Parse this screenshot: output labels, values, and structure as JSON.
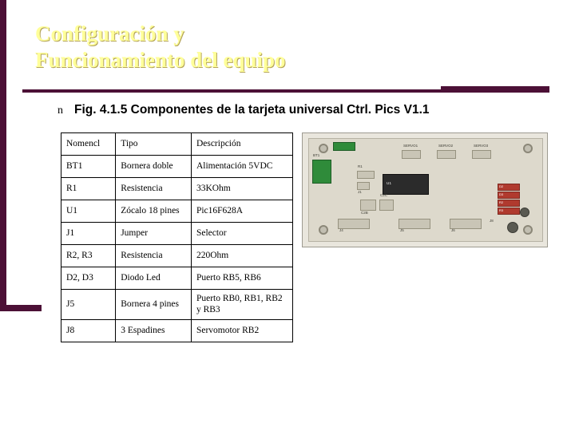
{
  "slide": {
    "title_line1": "Configuración y",
    "title_line2": "Funcionamiento del equipo",
    "bullet_marker": "n",
    "bullet_text": "Fig. 4.1.5 Componentes de la tarjeta universal Ctrl. Pics V1.1"
  },
  "colors": {
    "title_text": "#FFFF99",
    "accent_bar": "#4C1036",
    "background": "#FFFFFF"
  },
  "table": {
    "headers": [
      "Nomencl",
      "Tipo",
      "Descripción"
    ],
    "rows": [
      [
        "BT1",
        "Bornera doble",
        "Alimentación 5VDC"
      ],
      [
        "R1",
        "Resistencia",
        "33KOhm"
      ],
      [
        "U1",
        "Zócalo 18 pines",
        "Pic16F628A"
      ],
      [
        "J1",
        "Jumper",
        "Selector"
      ],
      [
        "R2, R3",
        "Resistencia",
        "220Ohm"
      ],
      [
        "D2, D3",
        "Diodo Led",
        "Puerto RB5, RB6"
      ],
      [
        "J5",
        "Bornera 4 pines",
        "Puerto RB0, RB1, RB2 y RB3"
      ],
      [
        "J8",
        "3 Espadines",
        "Servomotor RB2"
      ]
    ]
  },
  "board": {
    "alt": "Fotografía de la tarjeta universal Ctrl. Pics V1.1",
    "silkscreen": [
      "BT1",
      "R1",
      "U1",
      "J1",
      "J4",
      "J5",
      "J6",
      "J8",
      "SERVO1",
      "SERVO2",
      "SERVO3",
      "C2B",
      "C2C",
      "D2",
      "D3",
      "R2",
      "R3"
    ]
  }
}
